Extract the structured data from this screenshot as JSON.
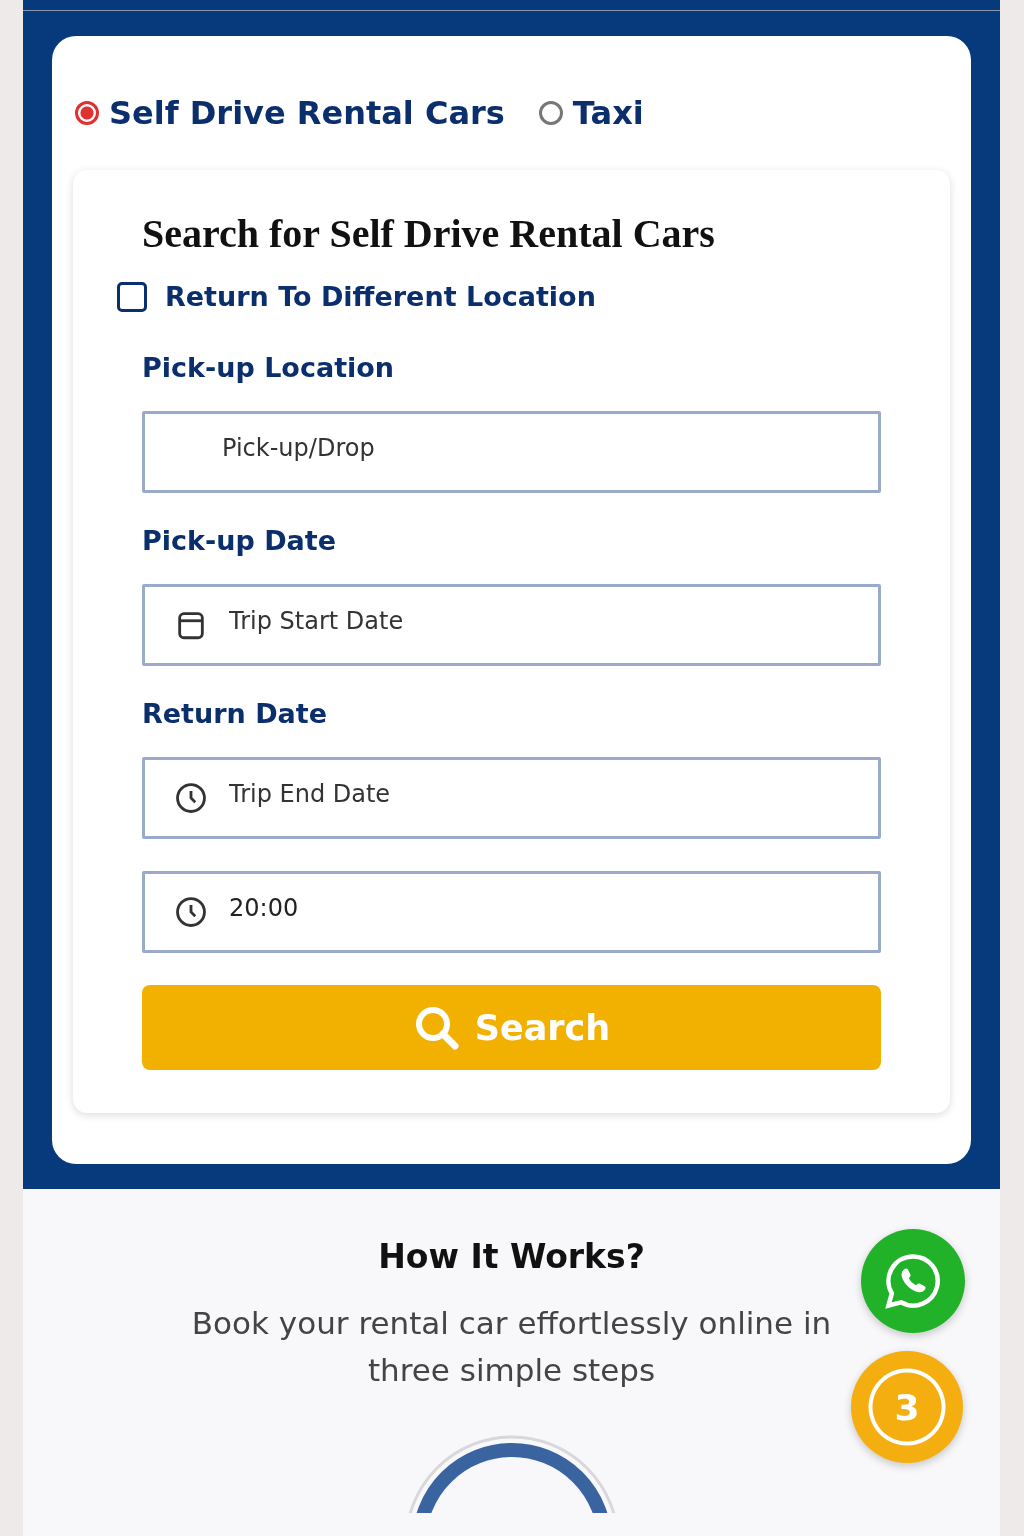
{
  "service_types": [
    {
      "label": "Self Drive Rental Cars",
      "selected": true
    },
    {
      "label": "Taxi",
      "selected": false
    }
  ],
  "search_form": {
    "title": "Search for Self Drive Rental Cars",
    "return_different": {
      "label": "Return To Different Location",
      "checked": false
    },
    "sections": [
      {
        "label": "Pick-up Location",
        "fields": [
          {
            "kind": "none",
            "placeholder": "Pick-up/Drop"
          }
        ]
      },
      {
        "label": "Pick-up Date",
        "fields": [
          {
            "kind": "calendar",
            "placeholder": "Trip Start Date"
          }
        ]
      },
      {
        "label": "Return Date",
        "fields": [
          {
            "kind": "clock",
            "placeholder": "Trip End Date"
          },
          {
            "kind": "clock",
            "value": "20:00"
          }
        ]
      }
    ],
    "button": "Search"
  },
  "how_it_works": {
    "title": "How It Works?",
    "subtitle": "Book your rental car effortlessly online in three simple steps"
  },
  "step_badge": "3"
}
